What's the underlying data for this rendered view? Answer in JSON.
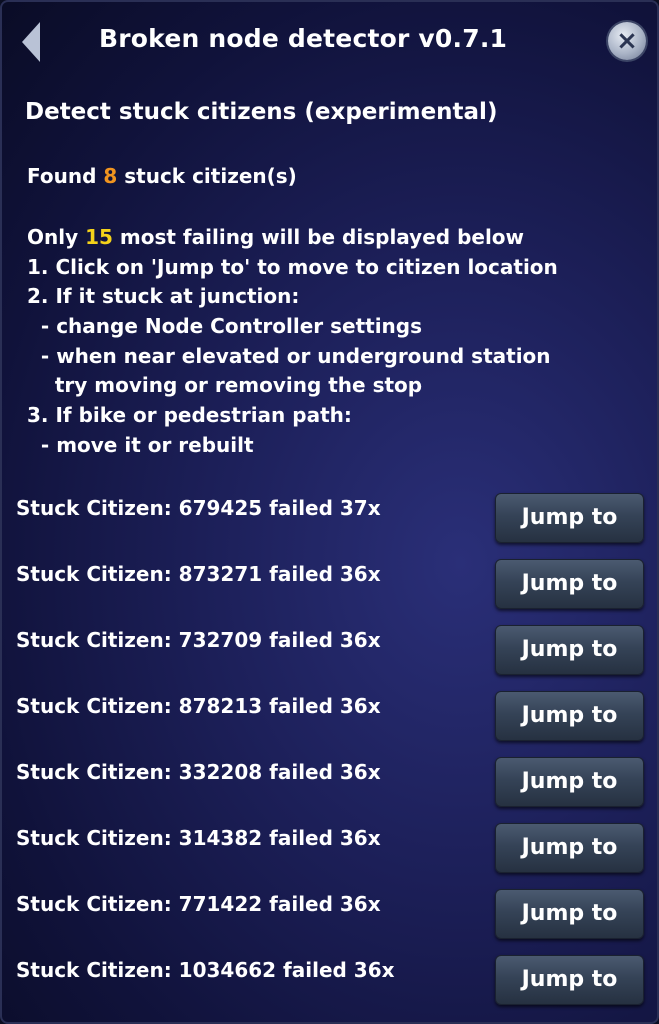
{
  "window": {
    "title": "Broken node detector v0.7.1",
    "close_icon": "close-icon",
    "back_icon": "back-arrow-icon"
  },
  "section": {
    "title": "Detect stuck citizens (experimental)"
  },
  "found": {
    "prefix": "Found ",
    "count": "8",
    "suffix": " stuck citizen(s)"
  },
  "instructions": {
    "line1_prefix": "Only ",
    "line1_count": "15",
    "line1_suffix": " most failing will be displayed below",
    "lines": [
      "1. Click on 'Jump to' to move to citizen location",
      "2. If it stuck at junction:",
      "  - change Node Controller settings",
      "  - when near elevated or underground station",
      "    try moving or removing the stop",
      "3. If bike or pedestrian path:",
      "  - move it or rebuilt"
    ]
  },
  "citizens": [
    {
      "label": "Stuck Citizen: 679425 failed 37x",
      "button": "Jump to"
    },
    {
      "label": "Stuck Citizen: 873271 failed 36x",
      "button": "Jump to"
    },
    {
      "label": "Stuck Citizen: 732709 failed 36x",
      "button": "Jump to"
    },
    {
      "label": "Stuck Citizen: 878213 failed 36x",
      "button": "Jump to"
    },
    {
      "label": "Stuck Citizen: 332208 failed 36x",
      "button": "Jump to"
    },
    {
      "label": "Stuck Citizen: 314382 failed 36x",
      "button": "Jump to"
    },
    {
      "label": "Stuck Citizen: 771422 failed 36x",
      "button": "Jump to"
    },
    {
      "label": "Stuck Citizen: 1034662 failed 36x",
      "button": "Jump to"
    }
  ],
  "colors": {
    "count_orange": "#f1941f",
    "count_yellow": "#f4d21a",
    "panel_bg": "#1c1f58"
  }
}
